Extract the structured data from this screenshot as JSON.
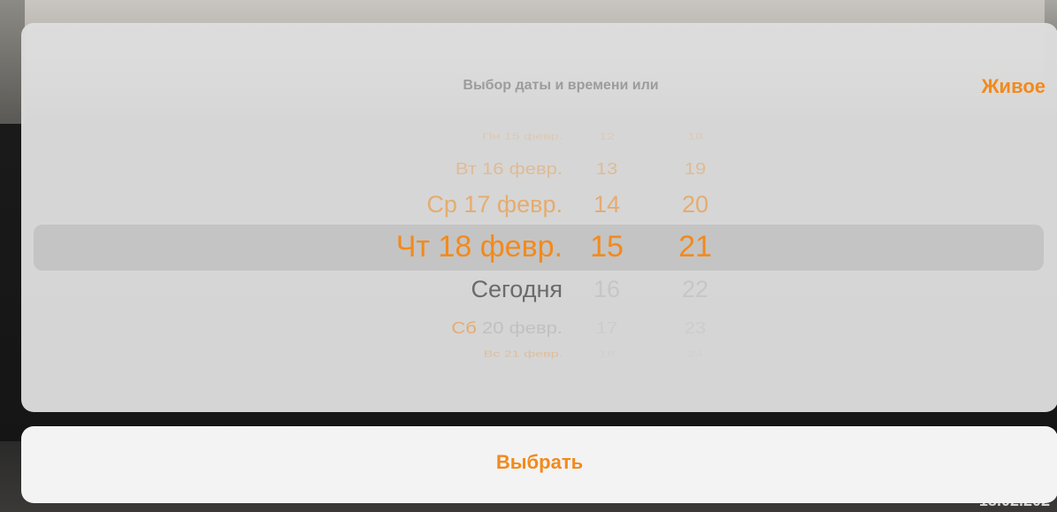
{
  "picker": {
    "title": "Выбор даты и времени или",
    "live_label": "Живое",
    "days": {
      "m3": "Пн 15 февр.",
      "m2": "Вт 16 февр.",
      "m1": "Ср 17 февр.",
      "selected": "Чт 18 февр.",
      "p1": "Сегодня",
      "p2_prefix": "Сб",
      "p2_rest": " 20 февр.",
      "p3": "Вс 21 февр."
    },
    "hours": {
      "m3": "12",
      "m2": "13",
      "m1": "14",
      "selected": "15",
      "p1": "16",
      "p2": "17",
      "p3": "18"
    },
    "minutes": {
      "m3": "18",
      "m2": "19",
      "m1": "20",
      "selected": "21",
      "p1": "22",
      "p2": "23",
      "p3": "24"
    }
  },
  "actions": {
    "select_label": "Выбрать"
  },
  "background": {
    "timestamp": "18.02.202"
  },
  "colors": {
    "accent": "#f28a1c",
    "card": "#dedede",
    "button_card": "#f3f3f3"
  }
}
